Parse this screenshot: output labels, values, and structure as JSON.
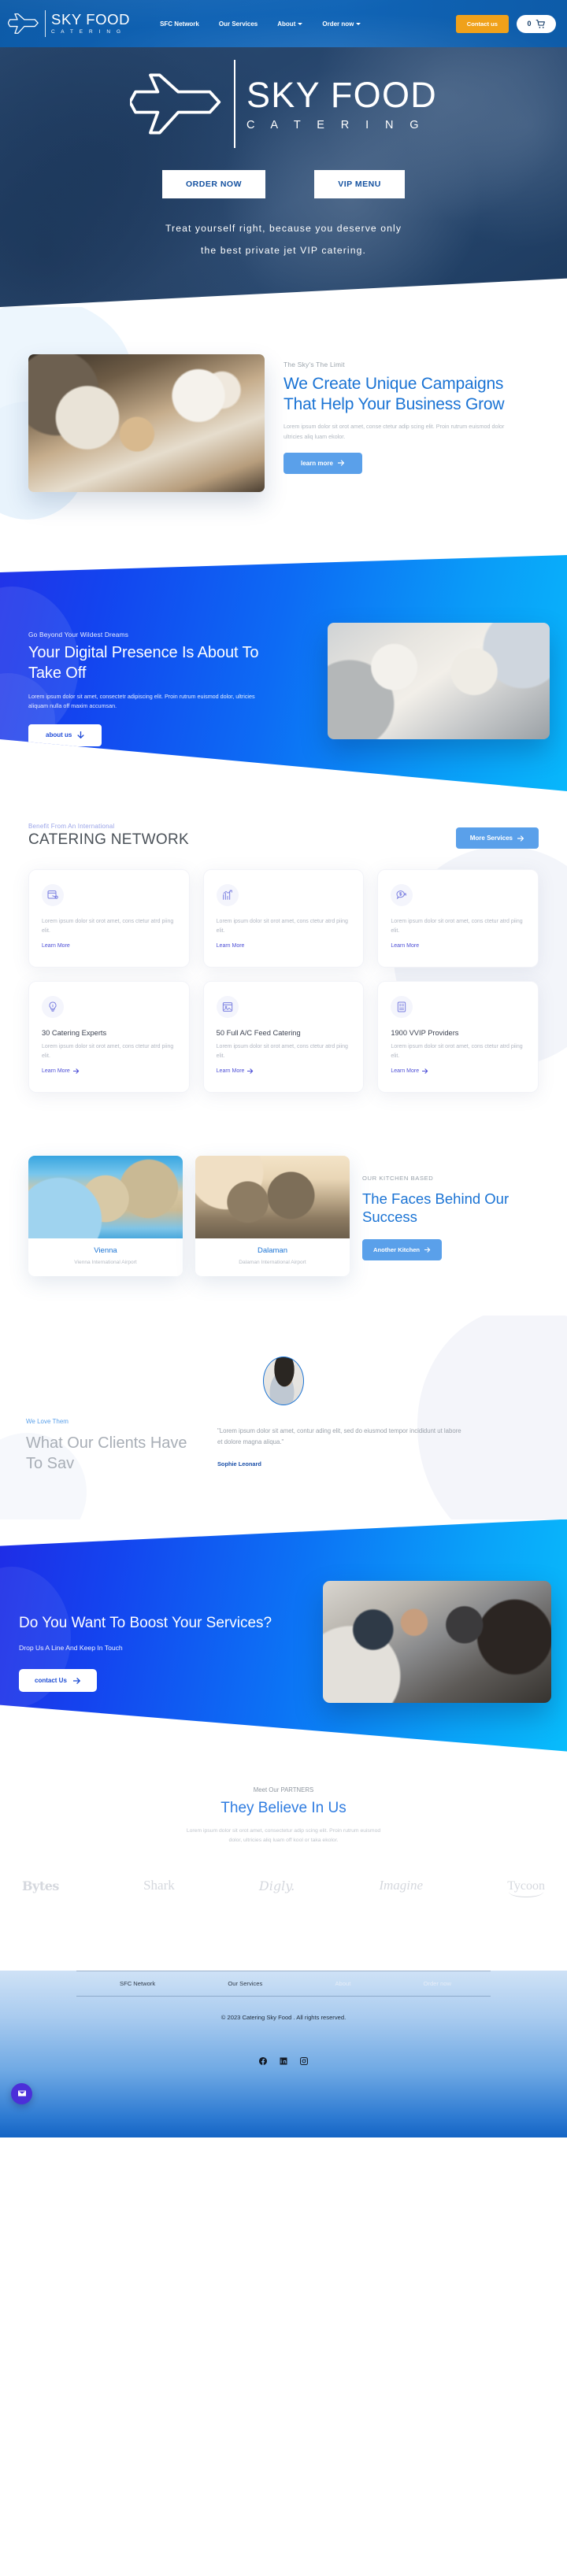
{
  "navbar": {
    "brand": {
      "title": "SKY FOOD",
      "subtitle": "C A T E R I N G"
    },
    "links": [
      {
        "label": "SFC Network",
        "caret": false
      },
      {
        "label": "Our Services",
        "caret": false
      },
      {
        "label": "About",
        "caret": true
      },
      {
        "label": "Order now",
        "caret": true
      }
    ],
    "contact_label": "Contact us",
    "cart_count": "0"
  },
  "hero": {
    "title": "SKY FOOD",
    "subtitle": "C A T E R I N G",
    "buttons": [
      "ORDER NOW",
      "VIP MENU"
    ],
    "tagline_line1": "Treat yourself right, because you deserve only",
    "tagline_line2": "the best private jet VIP catering."
  },
  "campaign": {
    "eyebrow": "The Sky's The Limit",
    "heading": "We Create Unique Campaigns That Help Your Business Grow",
    "body": "Lorem ipsum dolor sit orot amet, conse ctetur adip scing elit. Proin rutrum euismod dolor ultricies aliq luam ekolor.",
    "cta": "learn more"
  },
  "digital": {
    "eyebrow": "Go Beyond Your Wildest Dreams",
    "heading": "Your Digital Presence Is About To Take Off",
    "body": "Lorem ipsum dolor sit amet, consectetr adipiscing elit. Proin rutrum euismod dolor, ultricies aliquam nulla off  maxim accumsan.",
    "cta": "about us"
  },
  "network": {
    "eyebrow": "Benefit From An International",
    "heading": "CATERING NETWORK",
    "cta": "More Services",
    "cards": [
      {
        "icon": "share-window-icon",
        "title": "",
        "text": "Lorem ipsum dolor sit orot amet, cons ctetur atrd piing elit.",
        "link": "Learn More"
      },
      {
        "icon": "bar-chart-growth-icon",
        "title": "",
        "text": "Lorem ipsum dolor sit orot amet, cons ctetur atrd piing elit.",
        "link": "Learn More"
      },
      {
        "icon": "dollar-chat-icon",
        "title": "",
        "text": "Lorem ipsum dolor sit orot amet, cons ctetur atrd piing elit.",
        "link": "Learn More"
      },
      {
        "icon": "lightbulb-icon",
        "title": "30 Catering Experts",
        "text": "Lorem ipsum dolor sit orot amet, cons ctetur atrd piing elit.",
        "link": "Learn More"
      },
      {
        "icon": "image-window-icon",
        "title": "50 Full A/C Feed Catering",
        "text": "Lorem ipsum dolor sit orot amet, cons ctetur atrd piing elit.",
        "link": "Learn More"
      },
      {
        "icon": "document-text-icon",
        "title": "1900 VVIP Providers",
        "text": "Lorem ipsum dolor sit orot amet, cons ctetur atrd piing elit.",
        "link": "Learn More"
      }
    ]
  },
  "kitchens": {
    "eyebrow": "OUR KITCHEN BASED",
    "heading": "The Faces Behind Our Success",
    "cta": "Another Kitchen",
    "items": [
      {
        "name": "Vienna",
        "airport": "Vienna International Airport"
      },
      {
        "name": "Dalaman",
        "airport": "Dalaman International Airport"
      }
    ]
  },
  "testimonial": {
    "eyebrow": "We Love Them",
    "heading": "What Our Clients Have To Sav",
    "quote": "\"Lorem ipsum dolor sit amet, contur ading elit, sed do eiusmod tempor incididunt ut labore et dolore magna aliqua.\"",
    "author": "Sophie Leonard"
  },
  "boost": {
    "heading": "Do You Want To Boost Your Services?",
    "subtitle": "Drop Us A Line And Keep In Touch",
    "cta": "contact Us"
  },
  "partners": {
    "eyebrow": "Meet Our PARTNERS",
    "heading": "They Believe In Us",
    "body": "Lorem ipsum dolor sit orot amet, consectetur adip scing elit. Proin rutrum euismod dolor, ultricies aliq luam off kool or taka ekolor.",
    "logos": [
      "Bytes",
      "Shark",
      "Digly.",
      "Imagine",
      "Tycoon"
    ]
  },
  "footer": {
    "links": [
      "SFC Network",
      "Our Services",
      "About",
      "Order now"
    ],
    "copyright": "© 2023 Catering Sky Food . All rights reserved.",
    "social": [
      "facebook-icon",
      "linkedin-icon",
      "instagram-icon"
    ],
    "chat_icon": "mail-chat-icon"
  },
  "colors": {
    "nav_blue": "#0f62b4",
    "accent_orange": "#f0a11a",
    "brand_blue": "#1a73d4",
    "light_blue": "#5aa0ea",
    "violet": "#4d4fd6"
  }
}
